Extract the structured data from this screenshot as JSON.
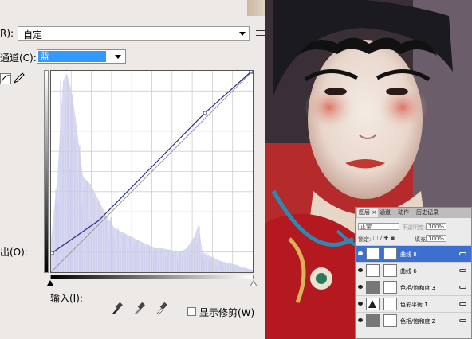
{
  "dialog": {
    "preset_label": "R):",
    "preset_value": "自定",
    "channel_label": "通道(C):",
    "channel_value": "蓝",
    "output_label": "出(O):",
    "input_label": "输入(I):",
    "show_clipping_label": "显示修剪(W)"
  },
  "layers_panel": {
    "tabs": [
      "图层 ×",
      "通道",
      "动作",
      "历史记录"
    ],
    "blend_mode": "正常",
    "opacity_label": "不透明度:",
    "opacity_value": "100%",
    "lock_label": "锁定:",
    "fill_label": "填充:",
    "fill_value": "100%",
    "layers": [
      {
        "name": "曲线 8",
        "selected": true
      },
      {
        "name": "曲线 6",
        "selected": false
      },
      {
        "name": "色相/饱和度 3",
        "selected": false
      },
      {
        "name": "色彩平衡 1",
        "selected": false
      },
      {
        "name": "色相/饱和度 2",
        "selected": false
      }
    ]
  },
  "colors": {
    "curve": "#2b2b8a",
    "histogram": "#d8d8f0",
    "selection": "#3399ff"
  }
}
